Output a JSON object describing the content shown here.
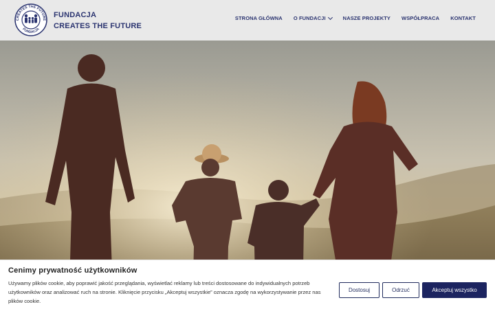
{
  "header": {
    "logo_ring_text_top": "CREATES THE FUTURE",
    "logo_ring_text_bottom": "FUNDACJA",
    "brand_line1": "FUNDACJA",
    "brand_line2": "CREATES THE FUTURE"
  },
  "nav": {
    "items": [
      {
        "label": "STRONA GŁÓWNA"
      },
      {
        "label": "O FUNDACJI",
        "has_dropdown": true
      },
      {
        "label": "NASZE PROJEKTY"
      },
      {
        "label": "WSPÓŁPRACA"
      },
      {
        "label": "KONTAKT"
      }
    ]
  },
  "cookie": {
    "title": "Cenimy prywatność użytkowników",
    "text": "Używamy plików cookie, aby poprawić jakość przeglądania, wyświetlać reklamy lub treści dostosowane do indywidualnych potrzeb użytkowników oraz analizować ruch na stronie. Kliknięcie przycisku „Akceptuj wszystkie” oznacza zgodę na wykorzystywanie przez nas plików cookie.",
    "customize_label": "Dostosuj",
    "reject_label": "Odrzuć",
    "accept_label": "Akceptuj wszystko"
  },
  "colors": {
    "brand": "#2b3470",
    "accept_bg": "#1c2460"
  }
}
